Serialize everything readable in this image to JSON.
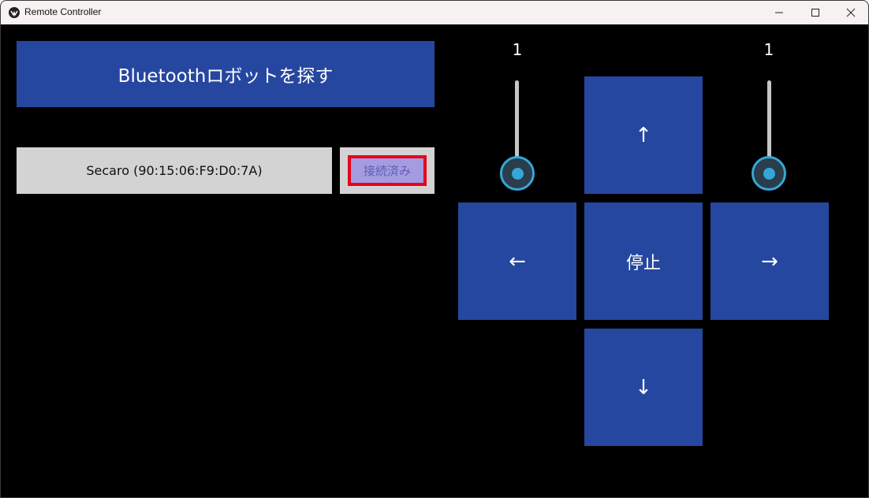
{
  "window": {
    "title": "Remote Controller"
  },
  "connection": {
    "search_label": "Bluetoothロボットを探す",
    "device_label": "Secaro (90:15:06:F9:D0:7A)",
    "status_label": "接続済み"
  },
  "sliders": {
    "left": {
      "value": "1"
    },
    "right": {
      "value": "1"
    }
  },
  "dpad": {
    "up": "↑",
    "left": "←",
    "stop": "停止",
    "right": "→",
    "down": "↓"
  },
  "colors": {
    "button_blue": "#2647a0",
    "status_highlight": "#e8001c",
    "slider_accent": "#35a6d8"
  }
}
